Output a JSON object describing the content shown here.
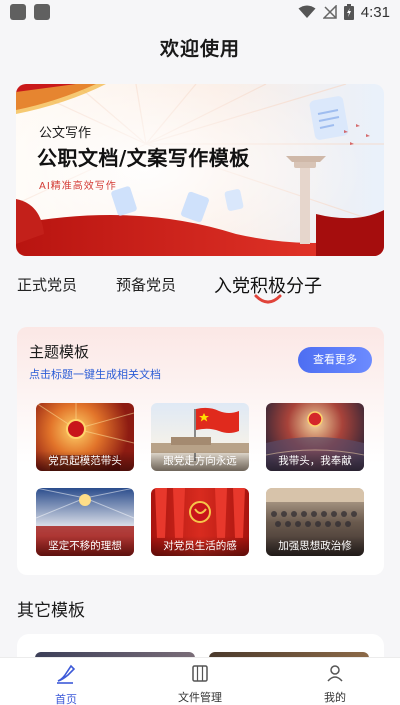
{
  "status_bar": {
    "time": "4:31"
  },
  "page": {
    "title": "欢迎使用"
  },
  "banner": {
    "tag": "公文写作",
    "title": "公职文档/文案写作模板",
    "subtitle": "AI精准高效写作"
  },
  "tabs": [
    {
      "label": "正式党员",
      "active": false
    },
    {
      "label": "预备党员",
      "active": false
    },
    {
      "label": "入党积极分子",
      "active": true
    }
  ],
  "theme_card": {
    "title": "主题模板",
    "subtitle": "点击标题一键生成相关文档",
    "more_label": "查看更多",
    "tiles": [
      {
        "label": "党员起模范带头"
      },
      {
        "label": "跟党走方向永远"
      },
      {
        "label": "我带头，我奉献"
      },
      {
        "label": "坚定不移的理想"
      },
      {
        "label": "对党员生活的感"
      },
      {
        "label": "加强思想政治修"
      }
    ]
  },
  "other": {
    "title": "其它模板"
  },
  "tabbar": {
    "items": [
      {
        "label": "首页",
        "icon": "home-pen-icon",
        "active": true
      },
      {
        "label": "文件管理",
        "icon": "file-cabinet-icon",
        "active": false
      },
      {
        "label": "我的",
        "icon": "user-icon",
        "active": false
      }
    ]
  },
  "colors": {
    "accent": "#3d5ad8",
    "party_red": "#d6281e",
    "link_blue": "#2c5dd6"
  }
}
